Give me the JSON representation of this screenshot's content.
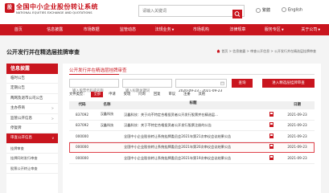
{
  "header": {
    "logo_text": "股",
    "brand_cn": "全国中小企业股份转让系统",
    "brand_en": "NATIONAL EQUITIES EXCHANGE AND QUOTATIONS",
    "search_placeholder": "请输入关键词",
    "lang": [
      "繁體",
      "English"
    ]
  },
  "nav": [
    {
      "label": "首页",
      "caret": false
    },
    {
      "label": "信息披露",
      "caret": false
    },
    {
      "label": "市场数据",
      "caret": false
    },
    {
      "label": "监管动态",
      "caret": false
    },
    {
      "label": "法规业务",
      "caret": true
    },
    {
      "label": "市场机构",
      "caret": false
    },
    {
      "label": "法律规章",
      "caret": false
    },
    {
      "label": "服务专区",
      "caret": true
    },
    {
      "label": "关于公司",
      "caret": true
    }
  ],
  "page": {
    "title": "公开发行并在精选层挂牌审查",
    "breadcrumb": "首页 > 信息披露 > 审查公开信息 > 公开发行并在精选层挂牌审查"
  },
  "sidebar": {
    "heading": "信息披露",
    "items": [
      {
        "label": "临时公告",
        "active": false,
        "arrow": false
      },
      {
        "label": "定期公告",
        "active": false,
        "arrow": false
      },
      {
        "label": "两网及退市公司公告",
        "active": false,
        "arrow": false
      },
      {
        "label": "主办券商",
        "active": false,
        "arrow": true
      },
      {
        "label": "监管公开信息",
        "active": false,
        "arrow": true
      },
      {
        "label": "停复牌",
        "active": false,
        "arrow": false
      },
      {
        "label": "审查公开信息",
        "active": true,
        "arrow": true
      },
      {
        "label": "挂牌审查",
        "active": false,
        "arrow": false,
        "sub": true
      },
      {
        "label": "挂牌同时发行审查",
        "active": false,
        "arrow": false,
        "sub": true
      },
      {
        "label": "股票公开转让审查",
        "active": false,
        "arrow": false,
        "sub": true
      }
    ]
  },
  "content": {
    "section_title": "公开发行并在精选层挂牌审查",
    "code_placeholder": "输入股票代码或名称",
    "keyword_placeholder": "输入标题关键词",
    "date_range": "2020-09-23 - 2021-09-23",
    "query_button": "查询",
    "enter_button": "进入精选层挂牌审查",
    "filter_label": "文件类型：",
    "filters": [
      {
        "label": "全部",
        "active": true
      },
      {
        "label": "申请",
        "active": false
      },
      {
        "label": "受理",
        "active": false
      },
      {
        "label": "问询",
        "active": false
      },
      {
        "label": "回复",
        "active": false
      },
      {
        "label": "审议",
        "active": false
      },
      {
        "label": "注册",
        "active": false
      },
      {
        "label": "其他",
        "active": false
      }
    ],
    "table": {
      "headers": [
        "代码",
        "名称",
        "标题",
        "",
        "日期"
      ],
      "rows": [
        {
          "code": "837092",
          "name": "汉鑫科技",
          "title": "汉鑫科技：关于向不特定合格投资者公开发行股票并在精选层...",
          "date": "2021-09-23",
          "hl": false
        },
        {
          "code": "837092",
          "name": "汉鑫科技",
          "title": "汉鑫科技：关于不特定合格投资者公开发行股票注册的公告",
          "date": "2021-09-23",
          "hl": false
        },
        {
          "code": "000000",
          "name": "",
          "title": "全国中小企业股份转让系统挂牌委员会2021年第21次审议会议结果公告",
          "date": "2021-09-23",
          "hl": false
        },
        {
          "code": "000000",
          "name": "",
          "title": "全国中小企业股份转让系统挂牌委员会2021年第20次审议会议结果公告",
          "date": "2021-09-23",
          "hl": true
        },
        {
          "code": "000000",
          "name": "",
          "title": "全国中小企业股份转让系统挂牌委员会2021年第19次审议会议结果公告",
          "date": "2021-09-23",
          "hl": false
        }
      ]
    }
  }
}
